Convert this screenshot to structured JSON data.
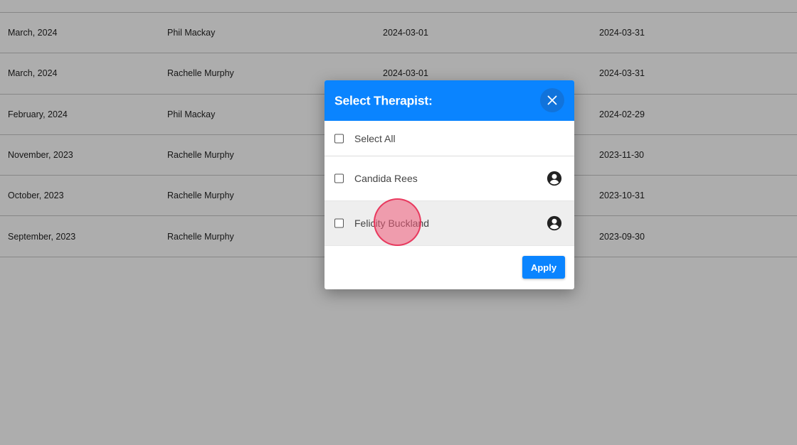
{
  "table": {
    "rows": [
      {
        "period": "March, 2024",
        "therapist": "Phil Mackay",
        "start": "2024-03-01",
        "end": "2024-03-31"
      },
      {
        "period": "March, 2024",
        "therapist": "Rachelle Murphy",
        "start": "2024-03-01",
        "end": "2024-03-31"
      },
      {
        "period": "February, 2024",
        "therapist": "Phil Mackay",
        "start": "",
        "end": "2024-02-29"
      },
      {
        "period": "November, 2023",
        "therapist": "Rachelle Murphy",
        "start": "",
        "end": "2023-11-30"
      },
      {
        "period": "October, 2023",
        "therapist": "Rachelle Murphy",
        "start": "",
        "end": "2023-10-31"
      },
      {
        "period": "September, 2023",
        "therapist": "Rachelle Murphy",
        "start": "",
        "end": "2023-09-30"
      }
    ]
  },
  "modal": {
    "title": "Select Therapist:",
    "select_all_label": "Select All",
    "options": [
      {
        "label": "Candida Rees",
        "checked": false,
        "icon": "account-circle-icon"
      },
      {
        "label": "Felicity Buckland",
        "checked": false,
        "icon": "account-circle-icon"
      }
    ],
    "apply_label": "Apply",
    "close_icon": "close-icon"
  },
  "colors": {
    "accent": "#0a84ff",
    "close_button_bg": "#1173db",
    "overlay": "rgba(0,0,0,0.32)",
    "hover_row": "#eeeeee",
    "click_indicator": "#f05a78"
  }
}
